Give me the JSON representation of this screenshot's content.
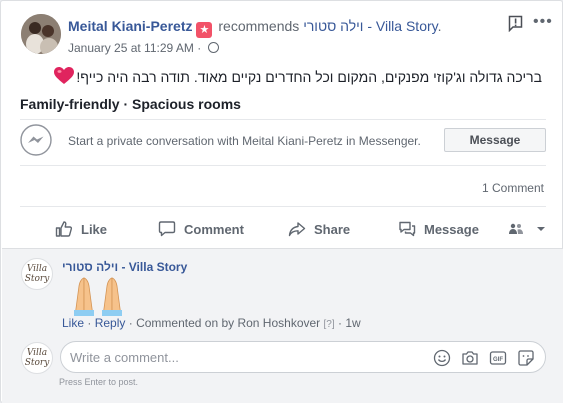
{
  "post": {
    "author": "Meital Kiani-Peretz",
    "recommends": "recommends",
    "page": "וילה סטורי - Villa Story",
    "page_suffix": ".",
    "timestamp": "January 25 at 11:29 AM",
    "meta_sep": "·",
    "review": "בריכה גדולה וג'קוזי מפנקים, המקום וכל החדרים נקיים מאוד. תודה רבה היה כייף!",
    "tags": "Family-friendly · Spacious rooms"
  },
  "messenger": {
    "text": "Start a private conversation with Meital Kiani-Peretz in Messenger.",
    "button": "Message"
  },
  "comment_count": "1 Comment",
  "actions": {
    "like": "Like",
    "comment": "Comment",
    "share": "Share",
    "message": "Message"
  },
  "comment": {
    "author": "וילה סטורי - Villa Story",
    "avatar_text": "Villa Story",
    "like": "Like",
    "reply": "Reply",
    "sep": "·",
    "commented_on": "Commented on by Ron Hoshkover",
    "help": "[?]",
    "age": "1w"
  },
  "composer": {
    "placeholder": "Write a comment...",
    "hint": "Press Enter to post."
  },
  "colors": {
    "link": "#385898",
    "muted": "#606770",
    "badge": "#f25268",
    "heart": "#e0245e"
  }
}
